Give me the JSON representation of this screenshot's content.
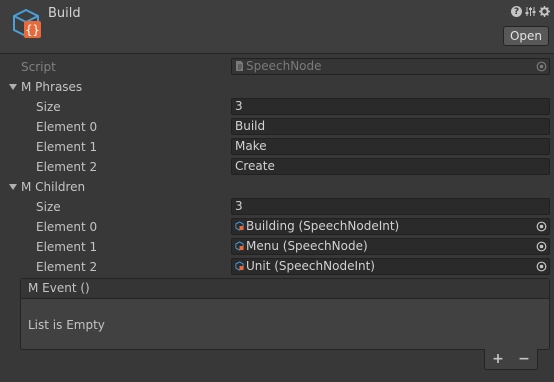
{
  "header": {
    "title": "Build",
    "open_label": "Open"
  },
  "script_row": {
    "label": "Script",
    "value": "SpeechNode"
  },
  "phrases": {
    "label": "M Phrases",
    "size_label": "Size",
    "size_value": "3",
    "elements": [
      {
        "label": "Element 0",
        "value": "Build"
      },
      {
        "label": "Element 1",
        "value": "Make"
      },
      {
        "label": "Element 2",
        "value": "Create"
      }
    ]
  },
  "children": {
    "label": "M Children",
    "size_label": "Size",
    "size_value": "3",
    "elements": [
      {
        "label": "Element 0",
        "value": "Building (SpeechNodeInt)"
      },
      {
        "label": "Element 1",
        "value": "Menu (SpeechNode)"
      },
      {
        "label": "Element 2",
        "value": "Unit (SpeechNodeInt)"
      }
    ]
  },
  "event": {
    "label": "M Event ()",
    "empty_text": "List is Empty",
    "add_label": "+",
    "remove_label": "−"
  },
  "icons": {
    "asset": "script-asset-icon",
    "help": "help-icon",
    "preset": "preset-icon",
    "settings": "settings-icon",
    "object": "scriptable-object-icon",
    "picker": "object-picker-icon"
  },
  "colors": {
    "accent_blue": "#4a9fd8",
    "accent_orange": "#e66a3b",
    "background": "#383838"
  }
}
